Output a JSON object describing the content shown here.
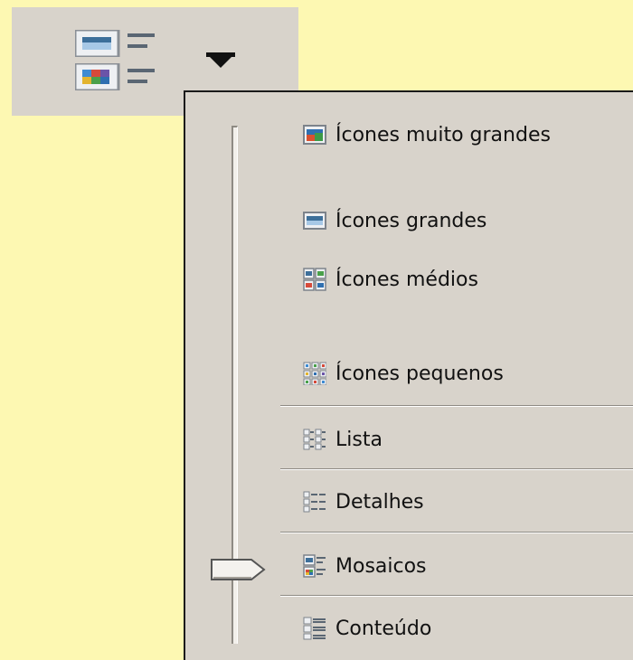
{
  "menu": {
    "items": [
      {
        "label": "Ícones muito grandes",
        "icon": "extra-large-icons-icon"
      },
      {
        "label": "Ícones grandes",
        "icon": "large-icons-icon"
      },
      {
        "label": "Ícones médios",
        "icon": "medium-icons-icon"
      },
      {
        "label": "Ícones pequenos",
        "icon": "small-icons-icon"
      },
      {
        "label": "Lista",
        "icon": "list-view-icon"
      },
      {
        "label": "Detalhes",
        "icon": "details-view-icon"
      },
      {
        "label": "Mosaicos",
        "icon": "tiles-view-icon"
      },
      {
        "label": "Conteúdo",
        "icon": "content-view-icon"
      }
    ],
    "selected": "Mosaicos"
  },
  "colors": {
    "page_background": "#fdf8b2",
    "menu_background": "#d8d3cb",
    "separator_dark": "#8e8a83"
  }
}
